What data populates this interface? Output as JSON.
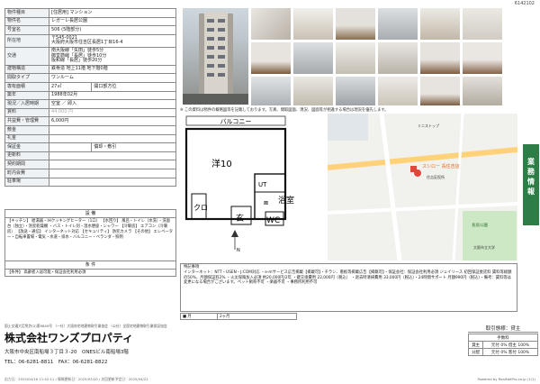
{
  "doc_id": "6142102",
  "rows": [
    {
      "label": "物件種目",
      "value": "[住居用] マンション"
    },
    {
      "label": "物件名",
      "value": "レガーレ長居公園"
    },
    {
      "label": "号室名",
      "value": "506 (5階部分)"
    },
    {
      "label": "所在地",
      "value": "〒545-0021\n大阪府大阪市住吉区長居1丁目16-4"
    },
    {
      "label": "交通",
      "value": "南大阪線「矢田」徒歩5分\n御堂筋線「長居」徒歩10分\n阪和線「長居」徒歩20分"
    },
    {
      "label": "建物構造",
      "value": "鉄骨造 地上11階 地下階0階"
    },
    {
      "label": "間取タイプ",
      "value": "ワンルーム"
    },
    {
      "label": "専有面積",
      "value": "27㎡",
      "label2": "開口部方位",
      "value2": ""
    },
    {
      "label": "築年",
      "value": "1988年02月"
    },
    {
      "label": "現況／入居時期",
      "value": "空室 ／ 即入"
    },
    {
      "label": "賃料",
      "value": "44,000 円"
    },
    {
      "label": "共益費・管理費",
      "value": "6,000円"
    },
    {
      "label": "敷金",
      "value": ""
    },
    {
      "label": "礼金",
      "value": ""
    },
    {
      "label": "保証金",
      "value": "",
      "label2": "償却・敷引",
      "value2": ""
    },
    {
      "label": "更新料",
      "value": ""
    },
    {
      "label": "契約期間",
      "value": ""
    },
    {
      "label": "町内会費",
      "value": ""
    },
    {
      "label": "駐車場",
      "value": ""
    }
  ],
  "features": {
    "heading": "設 備",
    "text": "【キッチン】 給湯器・IHクッキングヒーター（1口） 【水回り】 風呂・トイレ（水洗）・洗面台（独立）・浴室乾燥機 ・バス・トイレ別・温水便座・シャワー 【冷暖房】 エアコン（冷暖房） 【放送・通信】 インターネット対応 【セキュリティ】 防犯カメラ 【その他】 エレベーター・自転車置場・電気・水道・排水・バルコニー・ベランダ・照明"
  },
  "conditions": {
    "heading": "条 件",
    "text": "【条件】 高齢者入居可能・保証会社利用必須"
  },
  "note": "※ この資料は物件の概略図等を記載しております。写真、間取図面、現況、図面等が相違する場合は現況を優先します。",
  "floorplan": {
    "balcony": "バルコニー",
    "room": "洋10",
    "closet": "クロ",
    "entrance": "玄",
    "wc": "WC",
    "bath": "浴室",
    "ut": "UT",
    "north": "N"
  },
  "map": {
    "place1": "スシロー 長住吉店",
    "place2": "ミニストップ",
    "place3": "住吉区役所",
    "place4": "長居公園",
    "place5": "大阪市立大学"
  },
  "remarks": {
    "heading": "特記事項",
    "text": "インターネット：NTT・USEN・J:COM対応 ・e-mサービス広告掲載【掲載可】・チラシ、看板等掲載広告【掲載可】・保証会社：保証会社利用必須 ジェイリース 初回保証委託料 賃料等総額の50%、月額保証料2% ・火災保険加入必須 約20,000円/2年 ・鍵交換費用 22,000円（税込） ・退去時清掃費用 33,000円（税込）・24時間サポート 月額990円（税込）・備考：賃料等は変更になる場合がございます。ペット飼育不可 ・楽器不可 ・事務所利用不可",
    "bottom_label": "■ 月",
    "bottom_value": "2ヶ月"
  },
  "sidebar": [
    "業",
    "務",
    "情",
    "報"
  ],
  "footer": {
    "license": "国土交通大臣免許(2)第9849号 （一社）大阪府宅地建物取引業協会 （公社）全国宅地建物取引業保証協会",
    "company": "株式会社ワンズプロパティ",
    "address": "大阪市中央区南船場３丁目３-20　ONESビル南船場3階",
    "tel": "TEL：06-6281-8811　FAX：06-6281-8822"
  },
  "deal": {
    "title": "取引態様：貸主",
    "fee_label": "手数料",
    "rows": [
      [
        "貸主",
        "元付 0% 借主 100%"
      ],
      [
        "分配",
        "元付 0% 客付 100%"
      ]
    ]
  },
  "bottom": {
    "left": "出力日：2025/04/16 11:42:11 / 情報更新日：2025/03/20 / 次回更新予定日：2025/04/22",
    "right": "Powered by RealNetPro.co.jp (1/1)"
  }
}
